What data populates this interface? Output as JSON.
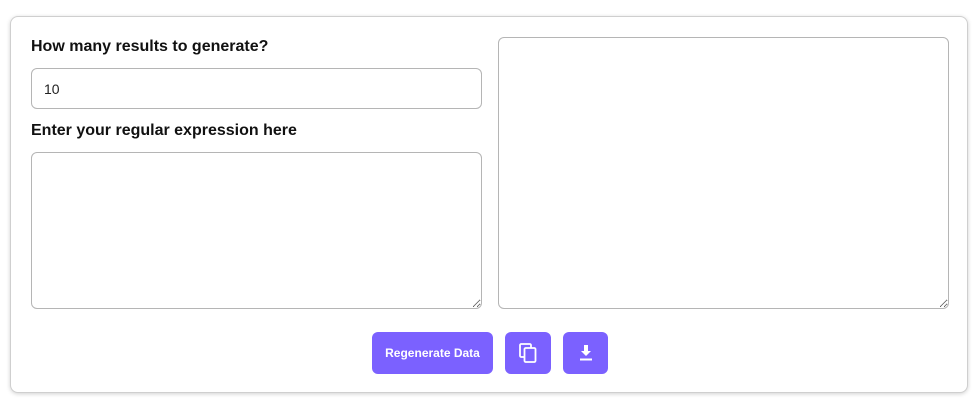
{
  "form": {
    "count_label": "How many results to generate?",
    "count_value": "10",
    "regex_label": "Enter your regular expression here",
    "regex_value": "",
    "output_value": ""
  },
  "actions": {
    "regenerate_label": "Regenerate Data",
    "copy_icon": "copy-icon",
    "download_icon": "download-icon"
  },
  "colors": {
    "accent": "#7b61ff",
    "border": "#b5b5b5",
    "text": "#111111"
  }
}
